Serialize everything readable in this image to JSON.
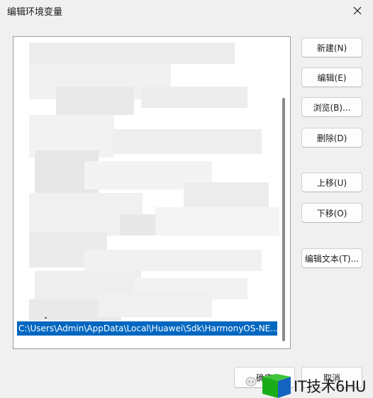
{
  "window": {
    "title": "编辑环境变量",
    "close_icon": "close-icon"
  },
  "list": {
    "selected_path": "C:\\Users\\Admin\\AppData\\Local\\Huawei\\Sdk\\HarmonyOS-NE..."
  },
  "buttons": {
    "new": "新建(N)",
    "edit": "编辑(E)",
    "browse": "浏览(B)...",
    "delete": "删除(D)",
    "move_up": "上移(U)",
    "move_down": "下移(O)",
    "edit_text": "编辑文本(T)...",
    "ok": "确定",
    "cancel": "取消"
  },
  "watermark": {
    "text": "IT技术6HU"
  },
  "colors": {
    "selection": "#0067c0",
    "accent_green": "#1aad19"
  }
}
